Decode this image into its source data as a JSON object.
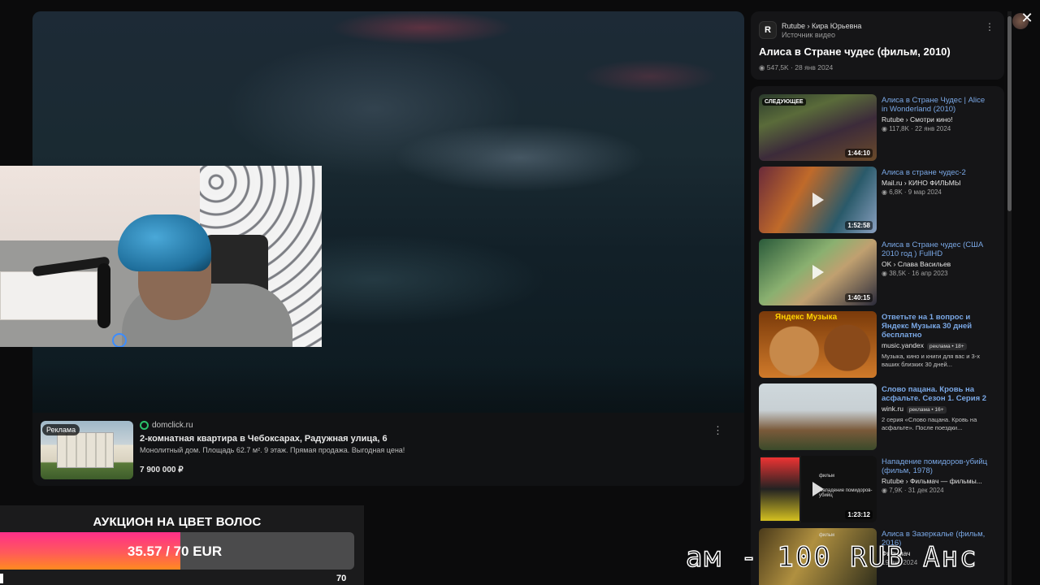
{
  "ad_block": {
    "label": "Реклама",
    "source": "domclick.ru",
    "title": "2-комнатная квартира в Чебоксарах, Радужная улица, 6",
    "description": "Монолитный дом. Площадь 62.7 м². 9 этаж. Прямая продажа. Выгодная цена!",
    "price": "7 900 000 ₽",
    "more": "⋮"
  },
  "sidebar_header": {
    "channel": "Rutube › Кира Юрьевна",
    "source_label": "Источник видео",
    "title": "Алиса в Стране чудес (фильм, 2010)",
    "meta": "◉ 547,5K · 28 янв 2024",
    "logo_letter": "R",
    "more": "⋮"
  },
  "recommendations": [
    {
      "title": "Алиса в Стране Чудес | Alice in Wonderland (2010)",
      "channel": "Rutube › Смотри кино!",
      "meta": "◉ 117,8K · 22 янв 2024",
      "duration": "1:44:10",
      "next_label": "СЛЕДУЮЩЕЕ"
    },
    {
      "title": "Алиса в стране чудес-2",
      "channel": "Mail.ru › КИНО ФИЛЬМЫ",
      "meta": "◉ 6,8K · 9 мар 2024",
      "duration": "1:52:58"
    },
    {
      "title": "Алиса в Стране чудес (США 2010 год ) FullHD",
      "channel": "OK › Слава Васильев",
      "meta": "◉ 38,5K · 16 апр 2023",
      "duration": "1:40:15"
    },
    {
      "title": "Ответьте на 1 вопрос и Яндекс Музыка 30 дней бесплатно",
      "channel": "music.yandex",
      "badge": "реклама • 18+",
      "desc": "Музыка, кино и книги для вас и 3-х ваших близких 30 дней...",
      "thumb_tag": "Яндекс Музыка"
    },
    {
      "title": "Слово пацана. Кровь на асфальте. Сезон 1. Серия 2",
      "channel": "wink.ru",
      "badge": "реклама • 16+",
      "desc": "2 серия «Слово пацана. Кровь на асфальте». После поездки..."
    },
    {
      "title": "Нападение помидоров-убийц (фильм, 1978)",
      "channel": "Rutube › Фильмач — фильмы...",
      "meta": "◉ 7,9K · 31 дек 2024",
      "duration": "1:23:12",
      "thumb_caption": "фильм",
      "thumb_caption2": "Нападение помидоров-убийц"
    },
    {
      "title": "Алиса в Зазеркалье (фильм, 2016)",
      "channel": "Фильмач",
      "meta": "19 янв 2024",
      "thumb_caption": "фильм"
    }
  ],
  "auction": {
    "title": "АУКЦИОН НА ЦВЕТ ВОЛОС",
    "value_text": "35.57 / 70 EUR",
    "current": 35.57,
    "max": 70,
    "max_label": "70"
  },
  "ticker": {
    "text": "ам - 100 RUB   Анс"
  },
  "colors": {
    "auction_fill_top": "#ff2f8a",
    "auction_fill_bottom": "#ff8a1f",
    "link_blue": "#7aa8e6"
  },
  "close": "✕"
}
